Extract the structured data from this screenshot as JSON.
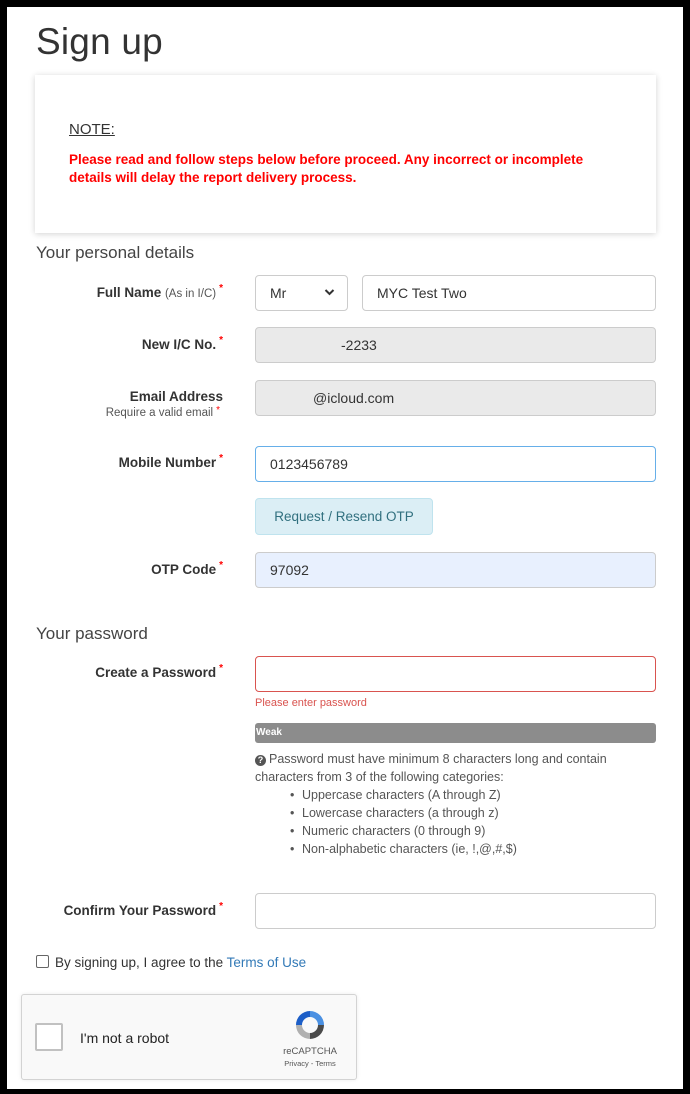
{
  "page_title": "Sign up",
  "note": {
    "label": "NOTE:",
    "text": "Please read and follow steps below before proceed. Any incorrect or incomplete details will delay the report delivery process."
  },
  "personal_section": {
    "title": "Your personal details",
    "full_name_label": "Full Name",
    "full_name_sub": "(As in I/C)",
    "salutation": "Mr",
    "full_name_value": "MYC Test Two",
    "ic_label": "New I/C No.",
    "ic_value": "-2233",
    "email_label": "Email Address",
    "email_sub": "Require a valid email",
    "email_value": "@icloud.com",
    "mobile_label": "Mobile Number",
    "mobile_value": "0123456789",
    "otp_button": "Request / Resend OTP",
    "otp_label": "OTP Code",
    "otp_value": "97092"
  },
  "password_section": {
    "title": "Your password",
    "create_label": "Create a Password",
    "error": "Please enter password",
    "strength": "Weak",
    "rule_intro": "Password must have minimum 8 characters long and contain characters from 3 of the following categories:",
    "rules": [
      "Uppercase characters (A through Z)",
      "Lowercase characters (a through z)",
      "Numeric characters (0 through 9)",
      "Non-alphabetic characters (ie, !,@,#,$)"
    ],
    "confirm_label": "Confirm Your Password"
  },
  "agreement": {
    "text": "By signing up, I agree to the",
    "link": "Terms of Use"
  },
  "recaptcha": {
    "label": "I'm not a robot",
    "brand": "reCAPTCHA",
    "links": "Privacy - Terms"
  },
  "required_mark": "*",
  "colors": {
    "required": "#ff0000",
    "link": "#337ab7",
    "error": "#d9534f",
    "strength_bar": "#8c8c8c"
  }
}
